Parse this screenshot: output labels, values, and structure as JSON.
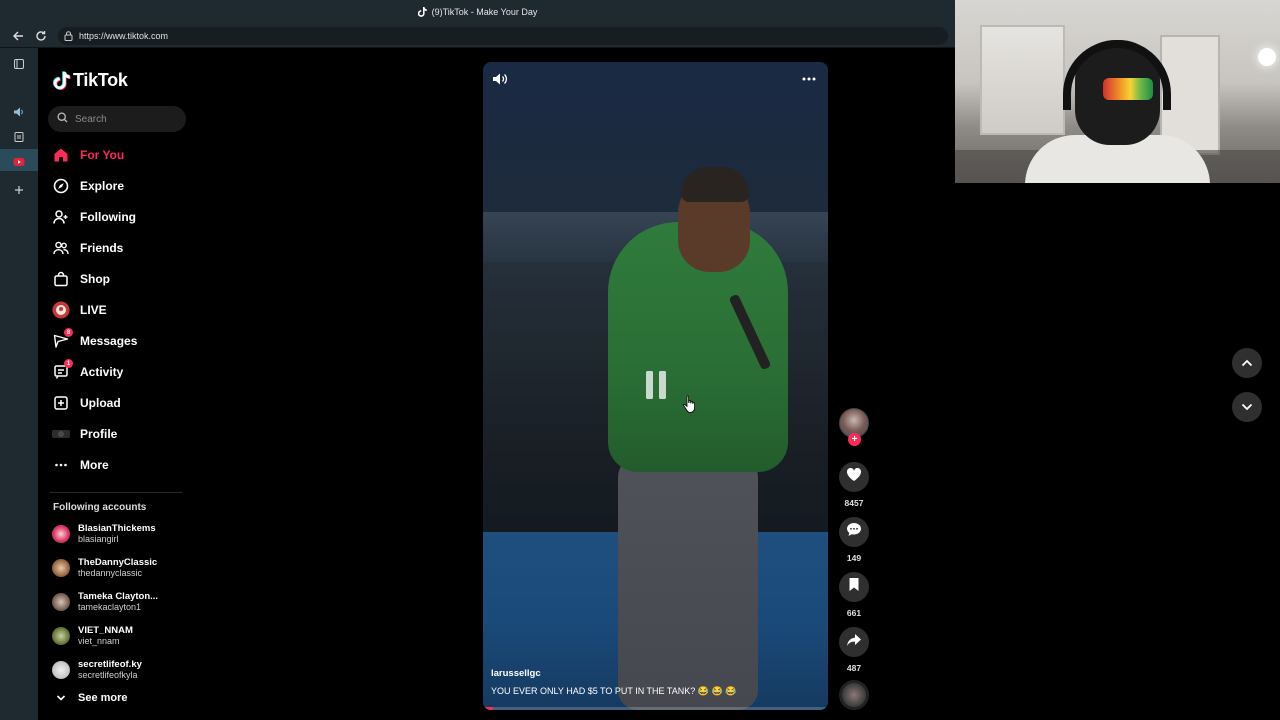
{
  "browser": {
    "tab_title": "(9)TikTok - Make Your Day",
    "url": "https://www.tiktok.com"
  },
  "sidebar": {
    "logo_text": "TikTok",
    "search_placeholder": "Search",
    "nav": [
      {
        "label": "For You",
        "icon": "home-icon",
        "active": true
      },
      {
        "label": "Explore",
        "icon": "compass-icon"
      },
      {
        "label": "Following",
        "icon": "person-add-icon"
      },
      {
        "label": "Friends",
        "icon": "friends-icon"
      },
      {
        "label": "Shop",
        "icon": "shop-icon"
      },
      {
        "label": "LIVE",
        "icon": "live-icon"
      },
      {
        "label": "Messages",
        "icon": "send-icon",
        "badge": "8"
      },
      {
        "label": "Activity",
        "icon": "activity-icon",
        "badge": "1"
      },
      {
        "label": "Upload",
        "icon": "upload-icon"
      },
      {
        "label": "Profile",
        "icon": "profile-avatar"
      },
      {
        "label": "More",
        "icon": "more-icon"
      }
    ],
    "following_title": "Following accounts",
    "accounts": [
      {
        "name": "BlasianThickems",
        "handle": "blasiangirl"
      },
      {
        "name": "TheDannyClassic",
        "handle": "thedannyclassic"
      },
      {
        "name": "Tameka Clayton...",
        "handle": "tamekaclayton1"
      },
      {
        "name": "VIET_NNAM",
        "handle": "viet_nnam"
      },
      {
        "name": "secretlifeof.ky",
        "handle": "secretlifeofkyla"
      }
    ],
    "see_more": "See more"
  },
  "video": {
    "author": "larussellgc",
    "caption": "YOU EVER ONLY HAD $5 TO PUT IN THE TANK? 😂 😂 😂",
    "progress": 0.03
  },
  "actions": {
    "likes": "8457",
    "comments": "149",
    "saves": "661",
    "shares": "487"
  },
  "colors": {
    "accent": "#fe2c55",
    "chrome": "#1f2a30",
    "action_bg": "#2f2f2f"
  }
}
